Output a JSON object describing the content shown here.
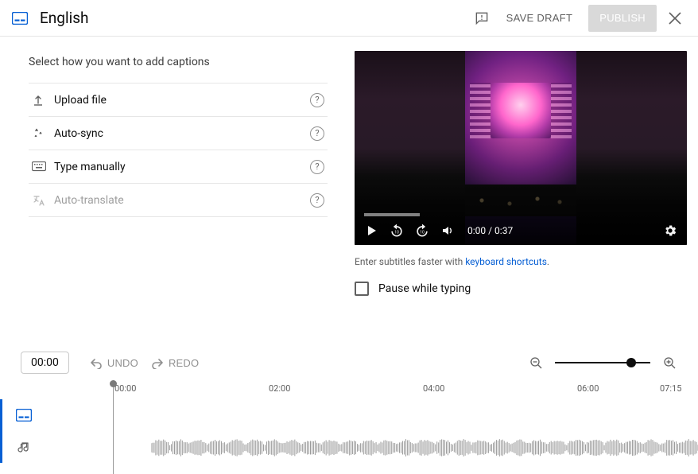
{
  "header": {
    "title": "English",
    "save_draft_label": "SAVE DRAFT",
    "publish_label": "PUBLISH"
  },
  "left": {
    "heading": "Select how you want to add captions",
    "options": {
      "upload": "Upload file",
      "autosync": "Auto-sync",
      "manual": "Type manually",
      "autotranslate": "Auto-translate"
    },
    "help_char": "?"
  },
  "video": {
    "current_time": "0:00",
    "separator": " / ",
    "duration": "0:37"
  },
  "hint": {
    "prefix": "Enter subtitles faster with ",
    "link": "keyboard shortcuts",
    "suffix": "."
  },
  "pause_label": "Pause while typing",
  "toolbar": {
    "time_value": "00:00",
    "undo_label": "UNDO",
    "redo_label": "REDO"
  },
  "ruler": {
    "m0": "00:00",
    "m2": "02:00",
    "m4": "04:00",
    "m6": "06:00",
    "mend": "07:15"
  }
}
